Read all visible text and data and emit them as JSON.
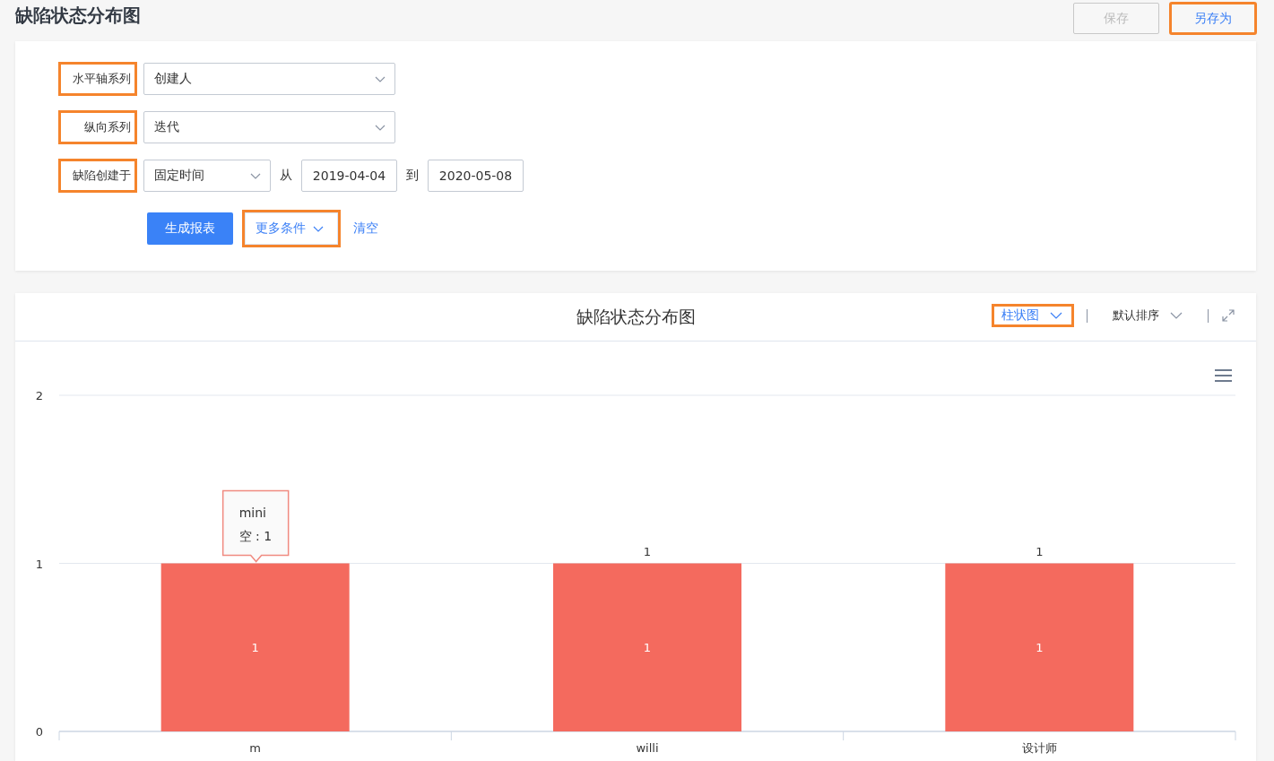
{
  "page_title": "缺陷状态分布图",
  "header_buttons": [
    {
      "label": "保存",
      "disabled": true,
      "highlighted": false
    },
    {
      "label": "另存为",
      "disabled": false,
      "highlighted": true
    }
  ],
  "filters": [
    {
      "label": "水平轴系列",
      "highlighted": true,
      "value": "创建人"
    },
    {
      "label": "纵向系列",
      "highlighted": true,
      "value": "迭代"
    },
    {
      "label": "缺陷创建于",
      "highlighted": true,
      "value": "固定时间",
      "from_label": "从",
      "from": "2019-04-04",
      "to_label": "到",
      "to": "2020-05-08"
    }
  ],
  "actions": {
    "generate": "生成报表",
    "more": {
      "label": "更多条件",
      "highlighted": true
    },
    "clear": "清空"
  },
  "chart_panel": {
    "title": "缺陷状态分布图",
    "chart_type": {
      "label": "柱状图",
      "highlighted": true
    },
    "sort": "默认排序",
    "tooltip": {
      "title": "mini",
      "line": "空 : 1"
    },
    "chart_data": {
      "type": "bar",
      "categories": [
        "m",
        "willi",
        "设计师"
      ],
      "series": [
        {
          "color": "#f46a5e",
          "values": [
            1,
            1,
            1
          ]
        }
      ],
      "ylim": [
        0,
        2
      ],
      "yticks": [
        0,
        1,
        2
      ],
      "data_labels": true,
      "annotations": [
        "1",
        "1",
        "1"
      ]
    }
  }
}
